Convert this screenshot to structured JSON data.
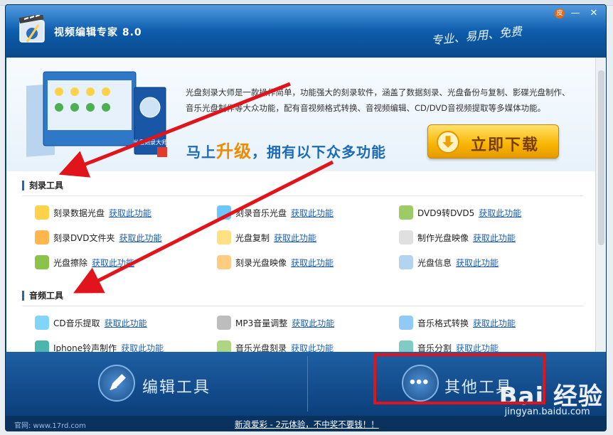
{
  "window": {
    "title": "视频编辑专家 8.0",
    "slogan": "专业、易用、免费",
    "controls": {
      "skin": "皮",
      "minimize": "—",
      "close": "✕"
    }
  },
  "banner": {
    "description": "光盘刻录大师是一款操作简单，功能强大的刻录软件，涵盖了数据刻录、光盘备份与复制、影碟光盘制作、音乐光盘制作等大众功能，配有音视频格式转换、音视频编辑、CD/DVD音视频提取等多媒体功能。",
    "upgrade_prefix": "马上",
    "upgrade_highlight": "升级",
    "upgrade_suffix": "，拥有以下众多功能",
    "download_button": "立即下载",
    "box_label": "光盘刻录大师"
  },
  "sections": [
    {
      "title": "刻录工具",
      "items": [
        {
          "name": "刻录数据光盘",
          "link": "获取此功能"
        },
        {
          "name": "刻录音乐光盘",
          "link": "获取此功能"
        },
        {
          "name": "DVD9转DVD5",
          "link": "获取此功能"
        },
        {
          "name": "刻录DVD文件夹",
          "link": "获取此功能"
        },
        {
          "name": "光盘复制",
          "link": "获取此功能"
        },
        {
          "name": "制作光盘映像",
          "link": "获取此功能"
        },
        {
          "name": "光盘擦除",
          "link": "获取此功能"
        },
        {
          "name": "刻录光盘映像",
          "link": "获取此功能"
        },
        {
          "name": "光盘信息",
          "link": "获取此功能"
        }
      ]
    },
    {
      "title": "音频工具",
      "items": [
        {
          "name": "CD音乐提取",
          "link": "获取此功能"
        },
        {
          "name": "MP3音量调整",
          "link": "获取此功能"
        },
        {
          "name": "音乐格式转换",
          "link": "获取此功能"
        },
        {
          "name": "Iphone铃声制作",
          "link": "获取此功能"
        },
        {
          "name": "音乐光盘刻录",
          "link": "获取此功能"
        },
        {
          "name": "音乐分割",
          "link": "获取此功能"
        }
      ]
    }
  ],
  "bottom_tabs": [
    {
      "label": "编辑工具"
    },
    {
      "label": "其他工具"
    }
  ],
  "footer": {
    "site": "官网: www.17rd.com",
    "ad": "新浪爱彩 - 2元体验，不中奖不要钱！！"
  },
  "watermark": {
    "brand": "Bai 经验",
    "url": "jingyan.baidu.com"
  },
  "colors": {
    "accent": "#1b6bb8",
    "link": "#1b5fb5",
    "highlight": "#f08a00",
    "annotation": "#e0141a"
  }
}
